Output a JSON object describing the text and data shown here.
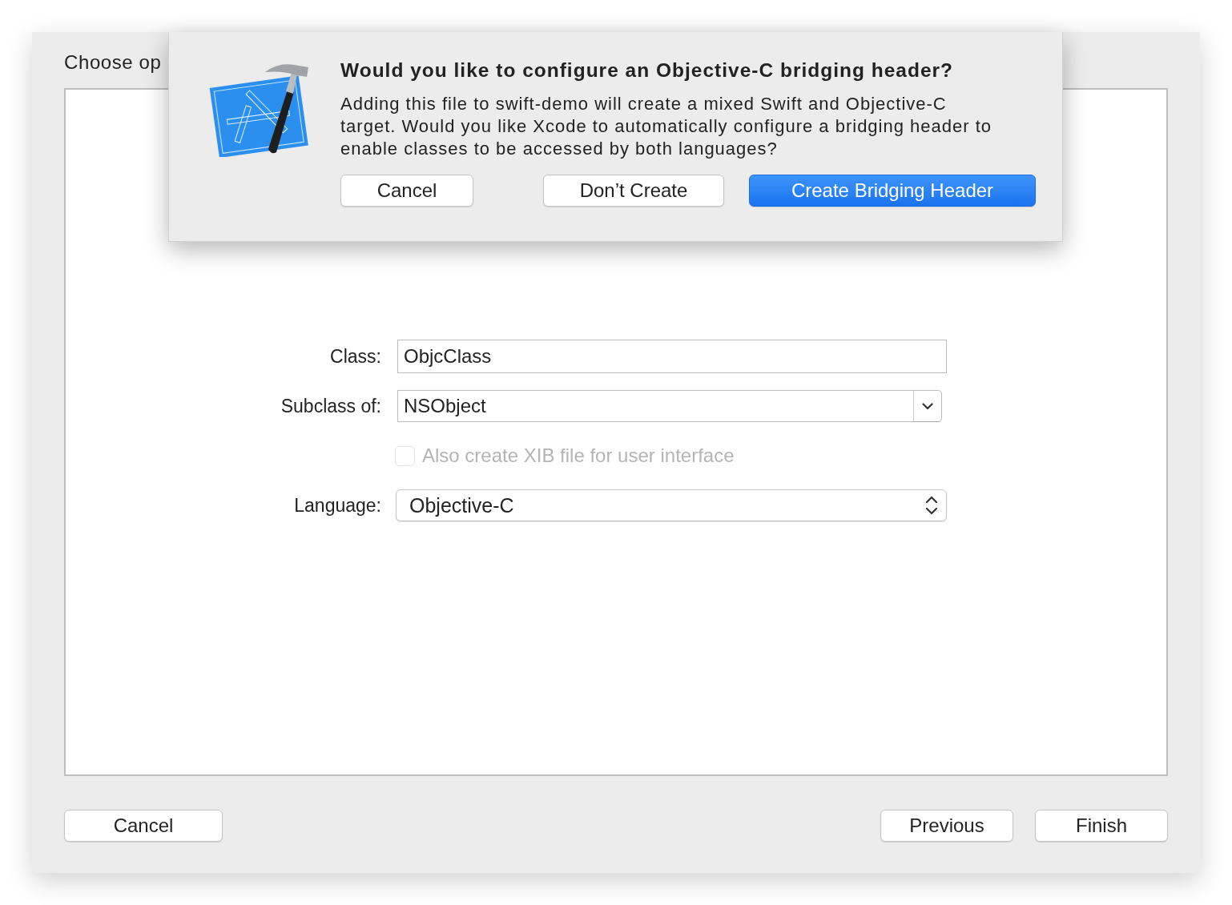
{
  "window": {
    "title": "Choose op"
  },
  "form": {
    "fields": [
      {
        "kind": "text",
        "label": "Class:",
        "value": "ObjcClass"
      },
      {
        "kind": "combo",
        "label": "Subclass of:",
        "value": "NSObject"
      },
      {
        "kind": "checkbox",
        "text": "Also create XIB file for user interface",
        "checked": false,
        "disabled": true
      },
      {
        "kind": "popup",
        "label": "Language:",
        "value": "Objective-C"
      }
    ]
  },
  "left_buttons": [
    "Cancel"
  ],
  "right_buttons": [
    "Previous",
    "Finish"
  ],
  "sheet": {
    "title": "Would you like to configure an Objective-C bridging header?",
    "message": "Adding this file to swift-demo will create a mixed Swift and Objective-C target. Would you like Xcode to automatically configure a bridging header to enable classes to be accessed by both languages?",
    "buttons": [
      {
        "label": "Cancel",
        "default": false
      },
      {
        "label": "Don’t Create",
        "default": false
      },
      {
        "label": "Create Bridging Header",
        "default": true
      }
    ]
  }
}
